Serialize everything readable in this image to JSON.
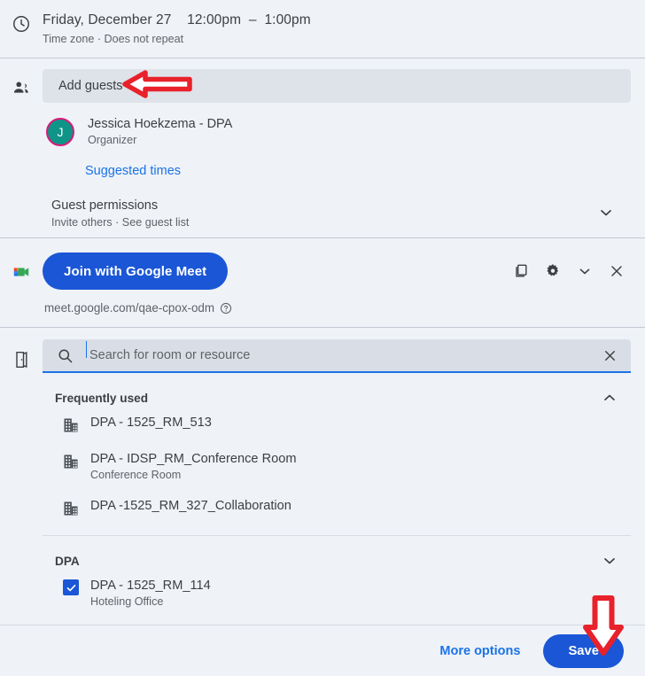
{
  "time_section": {
    "icon": "clock-icon",
    "datetime": "Friday, December 27    12:00pm  –  1:00pm",
    "subtitle": "Time zone · Does not repeat"
  },
  "guests_section": {
    "icon": "people-icon",
    "add_guests_placeholder": "Add guests",
    "organizer": {
      "avatar_initial": "J",
      "avatar_bg": "#0f9488",
      "avatar_ring": "#d81b78",
      "name": "Jessica Hoekzema - DPA",
      "role": "Organizer"
    },
    "suggested_times_label": "Suggested times",
    "guest_permissions": {
      "title": "Guest permissions",
      "subtitle": "Invite others · See guest list",
      "expander_icon": "chevron-down-icon"
    }
  },
  "meet_section": {
    "icon": "google-meet-icon",
    "join_button_label": "Join with Google Meet",
    "link": "meet.google.com/qae-cpox-odm",
    "help_icon": "help-circle-icon",
    "actions": [
      "copy-icon",
      "gear-icon",
      "chevron-down-icon",
      "close-icon"
    ]
  },
  "room_section": {
    "icon": "door-icon",
    "search": {
      "search_icon": "search-icon",
      "placeholder": "Search for room or resource",
      "value": "",
      "clear_icon": "close-icon"
    },
    "groups": [
      {
        "title": "Frequently used",
        "expander_icon": "chevron-up-icon",
        "expanded": true,
        "rooms": [
          {
            "icon": "building-icon",
            "name": "DPA - 1525_RM_513",
            "subtitle": "",
            "selected": false
          },
          {
            "icon": "building-icon",
            "name": "DPA - IDSP_RM_Conference Room",
            "subtitle": "Conference Room",
            "selected": false
          },
          {
            "icon": "building-icon",
            "name": "DPA -1525_RM_327_Collaboration",
            "subtitle": "",
            "selected": false
          }
        ]
      },
      {
        "title": "DPA",
        "expander_icon": "chevron-down-icon",
        "expanded": true,
        "rooms": [
          {
            "icon": "checkbox-checked-icon",
            "name": "DPA - 1525_RM_114",
            "subtitle": "Hoteling Office",
            "selected": true
          }
        ]
      }
    ]
  },
  "footer": {
    "more_options_label": "More options",
    "save_label": "Save"
  },
  "annotations": {
    "color": "#e8212a",
    "arrow_add_guests": "left-arrow-pointing-at-add-guests",
    "arrow_save": "down-arrow-pointing-at-save"
  },
  "colors": {
    "background": "#eff2f7",
    "field": "#dee2e9",
    "accent_blue": "#1a73e8",
    "button_blue": "#1a56d6",
    "text_primary": "#3c4043",
    "text_secondary": "#5f6368"
  }
}
